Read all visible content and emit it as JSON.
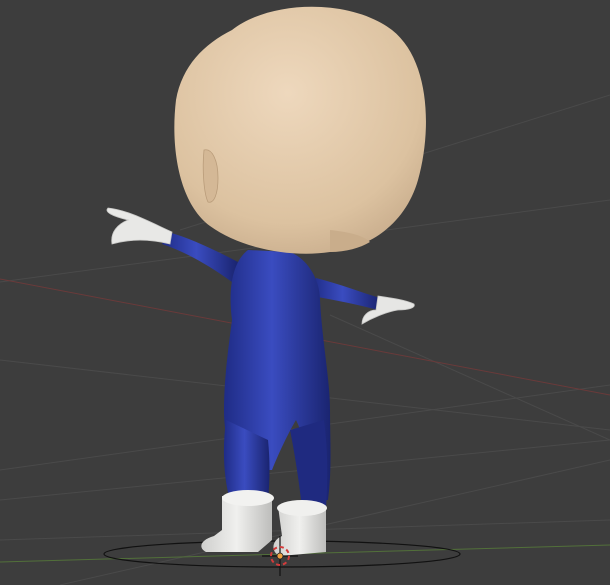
{
  "viewport": {
    "background_color": "#3d3d3d",
    "grid_color": "#4a4a4a",
    "x_axis_color": "#7a3f3f",
    "y_axis_color": "#5a7a3a"
  },
  "model": {
    "skin_color": "#e2c8a8",
    "suit_color": "#2a3aa0",
    "boot_color": "#e8e8e6",
    "glove_color": "#e6e6e4"
  },
  "gizmos": {
    "origin_icon": "origin-icon",
    "cursor_icon": "3d-cursor-icon",
    "cursor_color": "#d33b3b"
  }
}
